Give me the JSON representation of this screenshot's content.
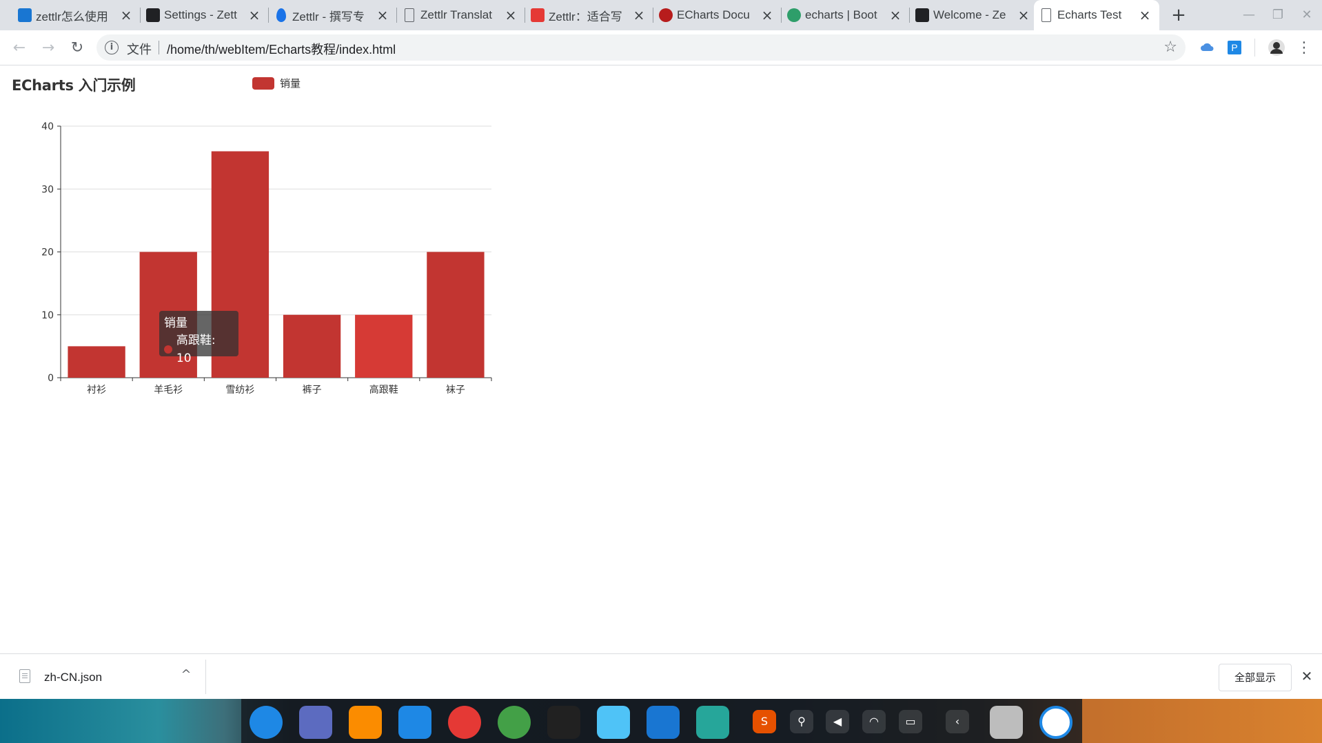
{
  "browser": {
    "tabs": [
      {
        "title": "zettlr怎么使用",
        "icon": "bing-icon",
        "icon_color": "#1976d2",
        "active": false
      },
      {
        "title": "Settings - Zett",
        "icon": "book-icon",
        "icon_color": "#202124",
        "active": false
      },
      {
        "title": "Zettlr - 撰写专",
        "icon": "drop-icon",
        "icon_color": "#1a73e8",
        "active": false
      },
      {
        "title": "Zettlr Translat",
        "icon": "page-icon",
        "icon_color": "#5f6368",
        "active": false
      },
      {
        "title": "Zettlr：适合写",
        "icon": "csdn-icon",
        "icon_color": "#e53935",
        "active": false
      },
      {
        "title": "ECharts Docu",
        "icon": "echarts-icon",
        "icon_color": "#b71c1c",
        "active": false
      },
      {
        "title": "echarts | Boot",
        "icon": "bootcdn-icon",
        "icon_color": "#2e9e6a",
        "active": false
      },
      {
        "title": "Welcome - Ze",
        "icon": "book-icon",
        "icon_color": "#202124",
        "active": false
      },
      {
        "title": "Echarts Test",
        "icon": "page-icon",
        "icon_color": "#5f6368",
        "active": true
      }
    ],
    "new_tab_symbol": "+",
    "window_controls": {
      "minimize": "—",
      "restore": "❐",
      "close": "✕"
    },
    "nav": {
      "back": "←",
      "forward": "→",
      "reload": "↻"
    },
    "omnibox": {
      "info": "i",
      "scheme_label": "文件",
      "url": "/home/th/webItem/Echarts教程/index.html",
      "star": "☆"
    },
    "extensions": [
      "cloud-icon",
      "p-extension-icon",
      "profile-avatar"
    ]
  },
  "page": {
    "title": "ECharts 入门示例"
  },
  "chart_data": {
    "type": "bar",
    "title": "ECharts 入门示例",
    "legend": [
      "销量"
    ],
    "legend_position": "top",
    "categories": [
      "衬衫",
      "羊毛衫",
      "雪纺衫",
      "裤子",
      "高跟鞋",
      "袜子"
    ],
    "series": [
      {
        "name": "销量",
        "values": [
          5,
          20,
          36,
          10,
          10,
          20
        ],
        "color": "#c23531"
      }
    ],
    "ylim": [
      0,
      40
    ],
    "yticks": [
      0,
      10,
      20,
      30,
      40
    ],
    "grid": true,
    "highlight_index": 4,
    "highlight_color": "#d63a35",
    "tooltip": {
      "series": "销量",
      "label": "高跟鞋: 10"
    }
  },
  "download_shelf": {
    "file_name": "zh-CN.json",
    "chevron": "^",
    "show_all": "全部显示",
    "close": "✕"
  },
  "taskbar": {
    "apps": [
      {
        "name": "deepin-launcher-icon",
        "color": "#1e88e5"
      },
      {
        "name": "desktop-monitor-icon",
        "color": "#5c6bc0"
      },
      {
        "name": "app-store-icon",
        "color": "#fb8c00"
      },
      {
        "name": "video-player-icon",
        "color": "#1e88e5"
      },
      {
        "name": "system-settings-icon",
        "color": "#e53935"
      },
      {
        "name": "chrome-icon",
        "color": "#43a047"
      },
      {
        "name": "typora-icon",
        "color": "#212121"
      },
      {
        "name": "file-manager-icon",
        "color": "#4fc3f7"
      },
      {
        "name": "vscode-icon",
        "color": "#1976d2"
      },
      {
        "name": "zettlr-icon",
        "color": "#26a69a"
      },
      {
        "name": "trash-icon",
        "color": "#bdbdbd"
      },
      {
        "name": "power-icon",
        "color": "#1e88e5"
      }
    ],
    "tray": [
      "sogou-input-icon",
      "usb-icon",
      "volume-icon",
      "wifi-icon",
      "battery-icon",
      "tray-collapse-icon"
    ]
  }
}
